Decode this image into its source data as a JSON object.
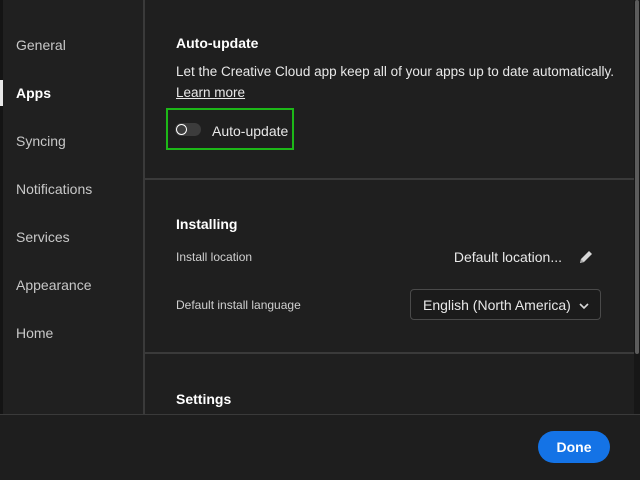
{
  "sidebar": {
    "items": [
      {
        "label": "General"
      },
      {
        "label": "Apps"
      },
      {
        "label": "Syncing"
      },
      {
        "label": "Notifications"
      },
      {
        "label": "Services"
      },
      {
        "label": "Appearance"
      },
      {
        "label": "Home"
      }
    ],
    "active": "Apps"
  },
  "auto_update": {
    "heading": "Auto-update",
    "description": "Let the Creative Cloud app keep all of your apps up to date automatically.",
    "learn_more": "Learn more",
    "toggle_label": "Auto-update",
    "enabled": false
  },
  "installing": {
    "heading": "Installing",
    "location_label": "Install location",
    "location_value": "Default location...",
    "language_label": "Default install language",
    "language_value": "English (North America)"
  },
  "settings": {
    "heading": "Settings"
  },
  "footer": {
    "done_label": "Done"
  },
  "colors": {
    "accent": "#1473e6",
    "highlight": "#1db818",
    "background": "#1e1e1e"
  }
}
